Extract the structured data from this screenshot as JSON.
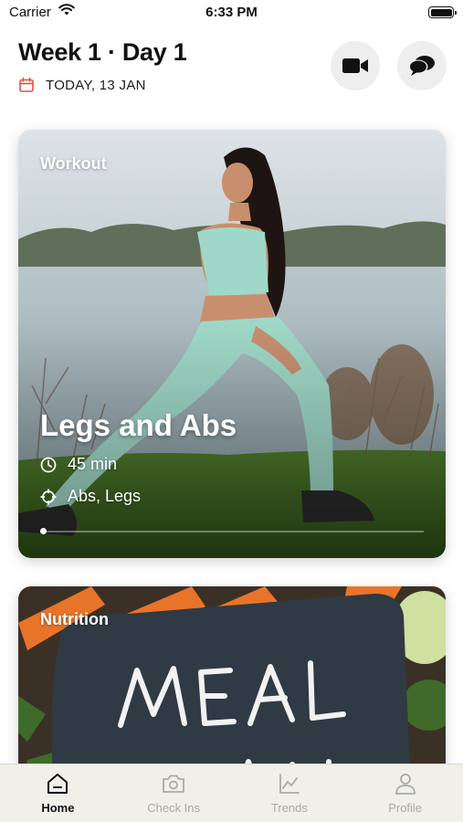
{
  "status_bar": {
    "carrier": "Carrier",
    "time": "6:33 PM"
  },
  "header": {
    "title": "Week 1 · Day 1",
    "date": "TODAY, 13 JAN"
  },
  "header_buttons": [
    {
      "icon": "video-camera-icon"
    },
    {
      "icon": "chat-bubbles-icon"
    }
  ],
  "workout_card": {
    "label": "Workout",
    "title": "Legs and Abs",
    "duration": "45 min",
    "focus": "Abs, Legs"
  },
  "nutrition_card": {
    "label": "Nutrition",
    "image_text": "MEAL PLAN"
  },
  "tab_bar": {
    "tabs": [
      {
        "label": "Home",
        "icon": "home-icon",
        "active": true
      },
      {
        "label": "Check Ins",
        "icon": "camera-icon",
        "active": false
      },
      {
        "label": "Trends",
        "icon": "chart-icon",
        "active": false
      },
      {
        "label": "Profile",
        "icon": "person-icon",
        "active": false
      }
    ]
  },
  "colors": {
    "accent_red": "#e0533d",
    "tab_bar_bg": "#f0f0e9",
    "button_bg": "#eeeeee"
  }
}
